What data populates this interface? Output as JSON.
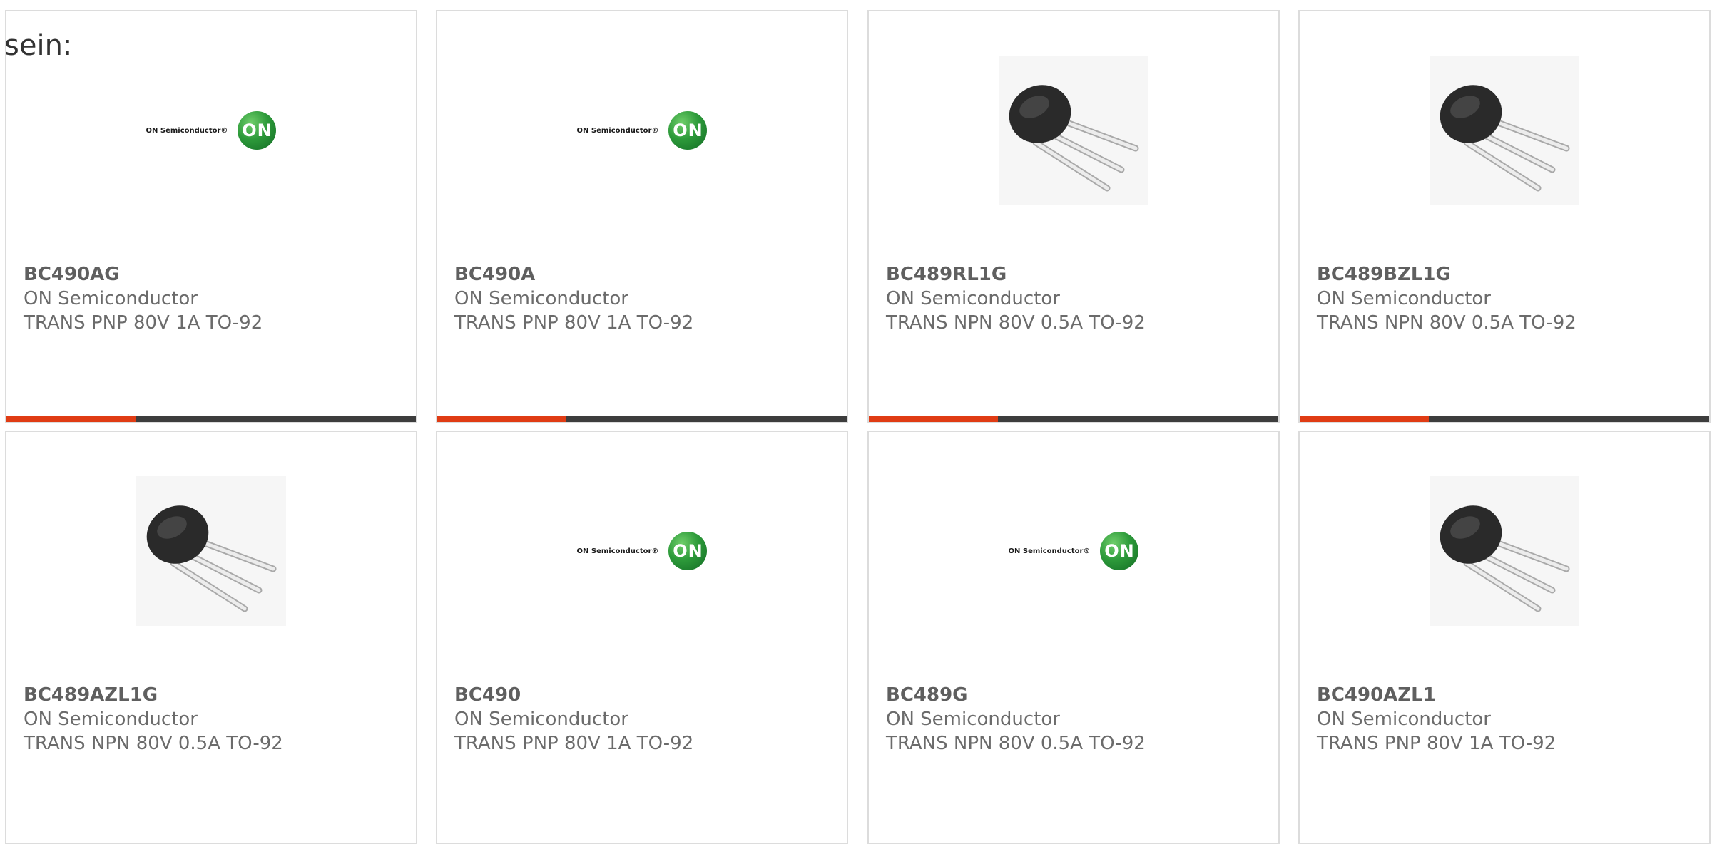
{
  "lead_text": "sein:",
  "accent_color": "#e03c14",
  "cards": [
    {
      "part_number": "BC490AG",
      "manufacturer": "ON Semiconductor",
      "description": "TRANS PNP 80V 1A TO-92",
      "image": "on-semiconductor-logo",
      "logo_text": "ON Semiconductor®",
      "logo_badge": "ON",
      "bar": "accent"
    },
    {
      "part_number": "BC490A",
      "manufacturer": "ON Semiconductor",
      "description": "TRANS PNP 80V 1A TO-92",
      "image": "on-semiconductor-logo",
      "logo_text": "ON Semiconductor®",
      "logo_badge": "ON",
      "bar": "accent"
    },
    {
      "part_number": "BC489RL1G",
      "manufacturer": "ON Semiconductor",
      "description": "TRANS NPN 80V 0.5A TO-92",
      "image": "to-92-package-photo",
      "bar": "accent"
    },
    {
      "part_number": "BC489BZL1G",
      "manufacturer": "ON Semiconductor",
      "description": "TRANS NPN 80V 0.5A TO-92",
      "image": "to-92-package-photo",
      "bar": "accent"
    },
    {
      "part_number": "BC489AZL1G",
      "manufacturer": "ON Semiconductor",
      "description": "TRANS NPN 80V 0.5A TO-92",
      "image": "to-92-package-photo"
    },
    {
      "part_number": "BC490",
      "manufacturer": "ON Semiconductor",
      "description": "TRANS PNP 80V 1A TO-92",
      "image": "on-semiconductor-logo",
      "logo_text": "ON Semiconductor®",
      "logo_badge": "ON"
    },
    {
      "part_number": "BC489G",
      "manufacturer": "ON Semiconductor",
      "description": "TRANS NPN 80V 0.5A TO-92",
      "image": "on-semiconductor-logo",
      "logo_text": "ON Semiconductor®",
      "logo_badge": "ON"
    },
    {
      "part_number": "BC490AZL1",
      "manufacturer": "ON Semiconductor",
      "description": "TRANS PNP 80V 1A TO-92",
      "image": "to-92-package-photo"
    }
  ]
}
